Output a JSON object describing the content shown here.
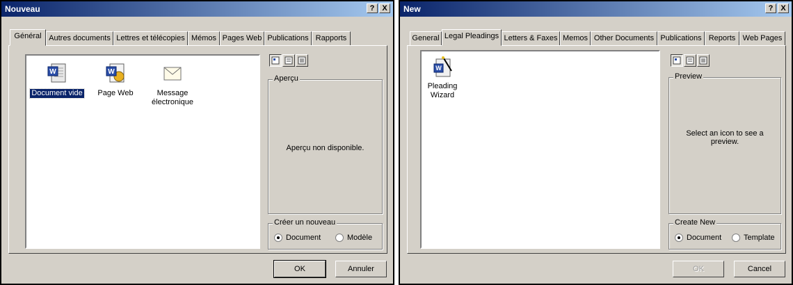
{
  "dialog_fr": {
    "title": "Nouveau",
    "help_btn": "?",
    "close_btn": "X",
    "tabs": [
      "Général",
      "Autres documents",
      "Lettres et télécopies",
      "Mémos",
      "Pages Web",
      "Publications",
      "Rapports"
    ],
    "active_tab": "Général",
    "items": [
      {
        "label": "Document vide",
        "icon": "word-document-icon",
        "selected": true
      },
      {
        "label": "Page Web",
        "icon": "word-web-page-icon",
        "selected": false
      },
      {
        "label": "Message électronique",
        "icon": "envelope-icon",
        "selected": false
      }
    ],
    "preview_title": "Aperçu",
    "preview_text": "Aperçu non disponible.",
    "create_title": "Créer un nouveau",
    "radio_document": "Document",
    "radio_template": "Modèle",
    "selected_radio": "Document",
    "ok": "OK",
    "cancel": "Annuler"
  },
  "dialog_en": {
    "title": "New",
    "help_btn": "?",
    "close_btn": "X",
    "tabs": [
      "General",
      "Legal Pleadings",
      "Letters & Faxes",
      "Memos",
      "Other Documents",
      "Publications",
      "Reports",
      "Web Pages"
    ],
    "active_tab": "Legal Pleadings",
    "items": [
      {
        "label": "Pleading Wizard",
        "icon": "wizard-document-icon",
        "selected": false
      }
    ],
    "preview_title": "Preview",
    "preview_text": "Select an icon to see a preview.",
    "create_title": "Create New",
    "radio_document": "Document",
    "radio_template": "Template",
    "selected_radio": "Document",
    "ok": "OK",
    "ok_disabled": true,
    "cancel": "Cancel"
  },
  "colors": {
    "titlebar_start": "#0a246a",
    "titlebar_end": "#a6caf0",
    "face": "#d4d0c8",
    "selection": "#0a246a"
  }
}
